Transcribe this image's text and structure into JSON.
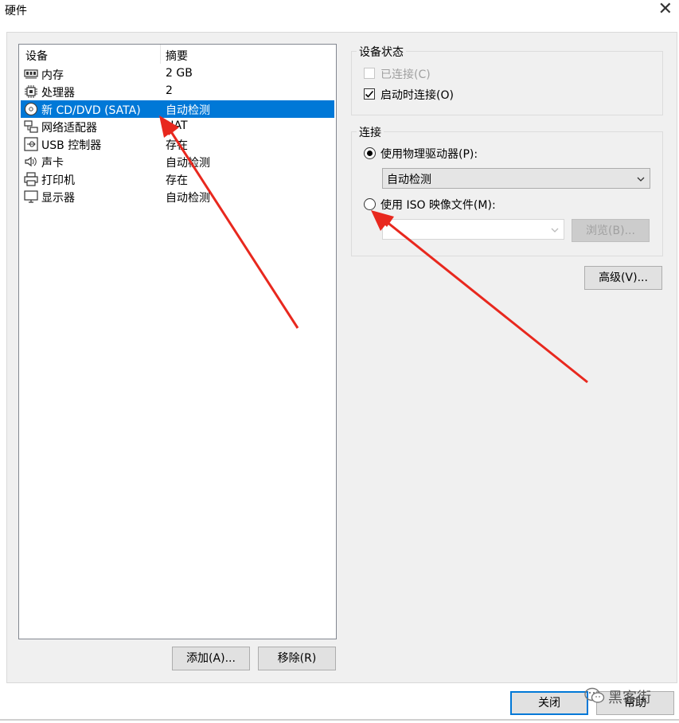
{
  "window": {
    "title": "硬件",
    "close_glyph": "✕"
  },
  "device_list": {
    "headers": {
      "device": "设备",
      "summary": "摘要"
    },
    "rows": [
      {
        "icon": "memory-icon",
        "name": "内存",
        "summary": "2 GB",
        "selected": false
      },
      {
        "icon": "processor-icon",
        "name": "处理器",
        "summary": "2",
        "selected": false
      },
      {
        "icon": "cd-dvd-icon",
        "name": "新 CD/DVD (SATA)",
        "summary": "自动检测",
        "selected": true
      },
      {
        "icon": "network-adapter-icon",
        "name": "网络适配器",
        "summary": "NAT",
        "selected": false
      },
      {
        "icon": "usb-icon",
        "name": "USB 控制器",
        "summary": "存在",
        "selected": false
      },
      {
        "icon": "sound-card-icon",
        "name": "声卡",
        "summary": "自动检测",
        "selected": false
      },
      {
        "icon": "printer-icon",
        "name": "打印机",
        "summary": "存在",
        "selected": false
      },
      {
        "icon": "display-icon",
        "name": "显示器",
        "summary": "自动检测",
        "selected": false
      }
    ]
  },
  "buttons": {
    "add": "添加(A)...",
    "remove": "移除(R)",
    "advanced": "高级(V)...",
    "close": "关闭",
    "help": "帮助"
  },
  "device_status": {
    "title": "设备状态",
    "connected": {
      "label": "已连接(C)",
      "checked": false,
      "enabled": false
    },
    "connect_at_power_on": {
      "label": "启动时连接(O)",
      "checked": true,
      "enabled": true
    }
  },
  "connection": {
    "title": "连接",
    "physical_drive": {
      "label": "使用物理驱动器(P):",
      "selected": true
    },
    "physical_drive_select": {
      "value": "自动检测"
    },
    "iso_image": {
      "label": "使用 ISO 映像文件(M):",
      "selected": false
    },
    "iso_select": {
      "value": ""
    },
    "browse": "浏览(B)..."
  },
  "watermark": {
    "text": "黑客街"
  },
  "colors": {
    "selection": "#0078d7",
    "panel_bg": "#f0f0f0",
    "annotation_arrow": "#e8281e"
  }
}
